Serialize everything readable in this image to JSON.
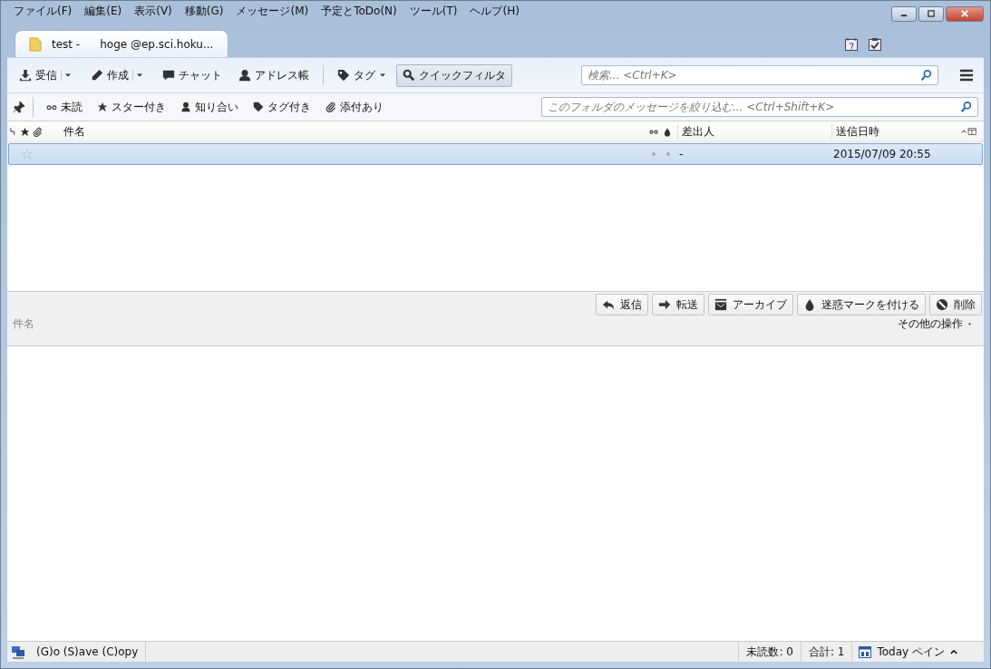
{
  "menu": [
    "ファイル(F)",
    "編集(E)",
    "表示(V)",
    "移動(G)",
    "メッセージ(M)",
    "予定とToDo(N)",
    "ツール(T)",
    "ヘルプ(H)"
  ],
  "tab": {
    "title": "test -",
    "account": "hoge @ep.sci.hoku...",
    "selected": true
  },
  "toolbar": [
    {
      "label": "受信",
      "kind": "split",
      "selected": false
    },
    {
      "label": "作成",
      "kind": "split",
      "selected": false
    },
    {
      "label": "チャット",
      "kind": "plain",
      "selected": false
    },
    {
      "label": "アドレス帳",
      "kind": "plain",
      "selected": false
    },
    {
      "label": "タグ",
      "kind": "dropdown",
      "selected": false
    },
    {
      "label": "クイックフィルタ",
      "kind": "plain",
      "selected": true
    }
  ],
  "search": {
    "placeholder": "検索... <Ctrl+K>"
  },
  "filters": [
    {
      "label": "未読",
      "selected": false
    },
    {
      "label": "スター付き",
      "selected": false
    },
    {
      "label": "知り合い",
      "selected": false
    },
    {
      "label": "タグ付き",
      "selected": false
    },
    {
      "label": "添付あり",
      "selected": false
    }
  ],
  "filter_search": {
    "placeholder": "このフォルダのメッセージを絞り込む... <Ctrl+Shift+K>"
  },
  "columns": {
    "subject": "件名",
    "sender": "差出人",
    "date": "送信日時"
  },
  "rows": [
    {
      "selected": true,
      "starred": false,
      "sender": "-",
      "date": "2015/07/09 20:55"
    }
  ],
  "message_header": {
    "buttons": [
      "返信",
      "転送",
      "アーカイブ",
      "迷惑マークを付ける",
      "削除"
    ],
    "subject_label": "件名",
    "more_actions": "その他の操作"
  },
  "status_bar": {
    "text": "(G)o (S)ave (C)opy",
    "unread": "未読数: 0",
    "total": "合計: 1",
    "today_pane": "Today ペイン"
  }
}
